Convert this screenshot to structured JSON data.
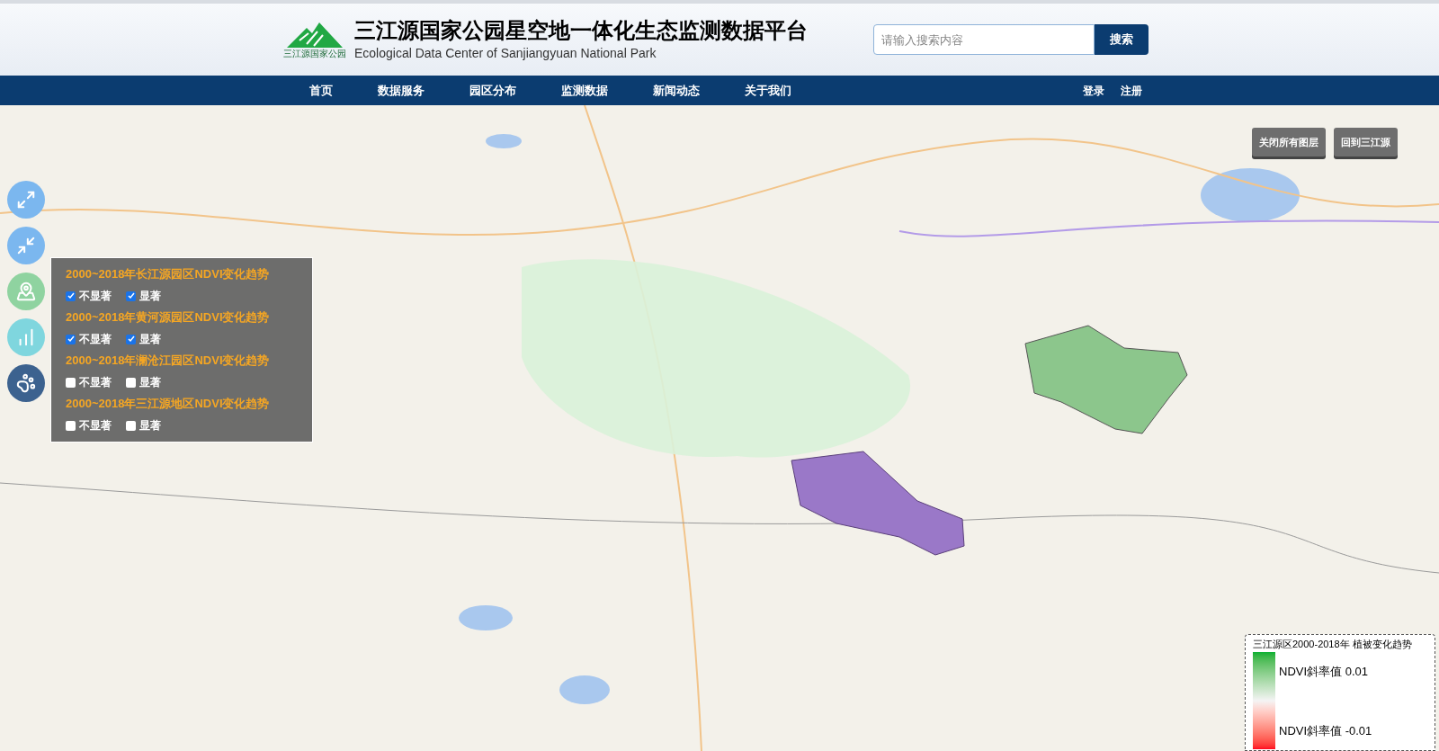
{
  "header": {
    "logo_caption": "三江源国家公园",
    "title": "三江源国家公园星空地一体化生态监测数据平台",
    "subtitle": "Ecological Data Center of Sanjiangyuan National Park",
    "search": {
      "placeholder": "请输入搜索内容",
      "button": "搜索"
    }
  },
  "nav": {
    "items": [
      {
        "label": "首页"
      },
      {
        "label": "数据服务"
      },
      {
        "label": "园区分布"
      },
      {
        "label": "监测数据"
      },
      {
        "label": "新闻动态"
      },
      {
        "label": "关于我们"
      }
    ],
    "account": [
      "登录",
      "注册"
    ]
  },
  "map": {
    "kind": "picture",
    "tools": [
      {
        "kind": "expand",
        "color": "#7bb7ef"
      },
      {
        "kind": "shrink",
        "color": "#7bb7ef"
      },
      {
        "kind": "location",
        "color": "#8fd3a0"
      },
      {
        "kind": "chart",
        "color": "#7fd6de"
      },
      {
        "kind": "animal",
        "color": "#3c628f"
      }
    ],
    "actions": [
      "关闭所有图层",
      "回到三江源"
    ],
    "layers": [
      {
        "title": "2000~2018年长江源园区NDVI变化趋势",
        "options": [
          {
            "label": "不显著",
            "checked": true
          },
          {
            "label": "显著",
            "checked": true
          }
        ]
      },
      {
        "title": "2000~2018年黄河源园区NDVI变化趋势",
        "options": [
          {
            "label": "不显著",
            "checked": true
          },
          {
            "label": "显著",
            "checked": true
          }
        ]
      },
      {
        "title": "2000~2018年澜沧江园区NDVI变化趋势",
        "options": [
          {
            "label": "不显著",
            "checked": false
          },
          {
            "label": "显著",
            "checked": false
          }
        ]
      },
      {
        "title": "2000~2018年三江源地区NDVI变化趋势",
        "options": [
          {
            "label": "不显著",
            "checked": false
          },
          {
            "label": "显著",
            "checked": false
          }
        ]
      }
    ],
    "legend": {
      "title": "三江源区2000-2018年 植被变化趋势",
      "high": "NDVI斜率值 0.01",
      "low": "NDVI斜率值 -0.01"
    }
  }
}
